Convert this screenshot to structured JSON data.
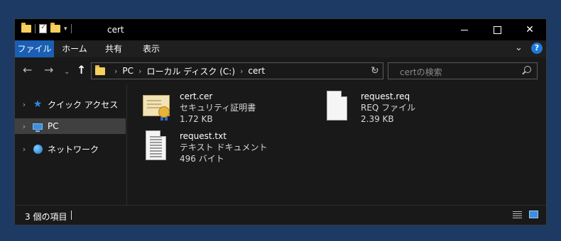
{
  "window": {
    "title": "cert"
  },
  "ribbon": {
    "tabs": [
      "ファイル",
      "ホーム",
      "共有",
      "表示"
    ]
  },
  "address": {
    "crumbs": [
      "PC",
      "ローカル ディスク (C:)",
      "cert"
    ]
  },
  "search": {
    "placeholder": "certの検索"
  },
  "sidebar": {
    "items": [
      {
        "label": "クイック アクセス",
        "icon": "quick-access-star-icon"
      },
      {
        "label": "PC",
        "icon": "pc-icon",
        "selected": true
      },
      {
        "label": "ネットワーク",
        "icon": "network-icon"
      }
    ]
  },
  "files": [
    {
      "name": "cert.cer",
      "type": "セキュリティ証明書",
      "size": "1.72 KB",
      "icon": "certificate-icon"
    },
    {
      "name": "request.req",
      "type": "REQ ファイル",
      "size": "2.39 KB",
      "icon": "blank-document-icon"
    },
    {
      "name": "request.txt",
      "type": "テキスト ドキュメント",
      "size": "496 バイト",
      "icon": "text-document-icon"
    }
  ],
  "status": {
    "item_count": "3 個の項目"
  },
  "colors": {
    "accent": "#1a5fb4",
    "background": "#191919",
    "titlebar": "#000000"
  }
}
